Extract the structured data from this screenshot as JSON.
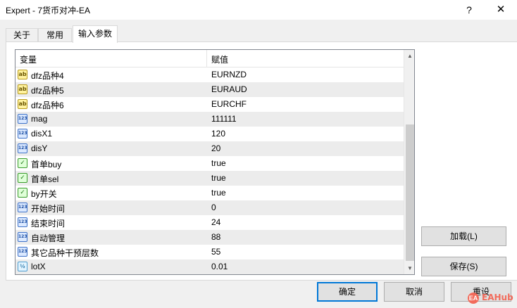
{
  "window": {
    "title": "Expert - 7货币对冲-EA",
    "help_label": "?",
    "close_label": "✕"
  },
  "tabs": [
    {
      "label": "关于"
    },
    {
      "label": "常用"
    },
    {
      "label": "输入参数"
    }
  ],
  "grid": {
    "col_variable": "变量",
    "col_value": "赋值",
    "rows": [
      {
        "icon": "string-type-icon",
        "icon_text": "ab",
        "type": "str",
        "variable": "dfz品种4",
        "value": "EURNZD"
      },
      {
        "icon": "string-type-icon",
        "icon_text": "ab",
        "type": "str",
        "variable": "dfz品种5",
        "value": "EURAUD"
      },
      {
        "icon": "string-type-icon",
        "icon_text": "ab",
        "type": "str",
        "variable": "dfz品种6",
        "value": "EURCHF"
      },
      {
        "icon": "integer-type-icon",
        "icon_text": "123",
        "type": "int",
        "variable": "mag",
        "value": "111111"
      },
      {
        "icon": "integer-type-icon",
        "icon_text": "123",
        "type": "int",
        "variable": "disX1",
        "value": "120"
      },
      {
        "icon": "integer-type-icon",
        "icon_text": "123",
        "type": "int",
        "variable": "disY",
        "value": "20"
      },
      {
        "icon": "boolean-type-icon",
        "icon_text": "✓",
        "type": "bool",
        "variable": "首单buy",
        "value": "true"
      },
      {
        "icon": "boolean-type-icon",
        "icon_text": "✓",
        "type": "bool",
        "variable": "首单sel",
        "value": "true"
      },
      {
        "icon": "boolean-type-icon",
        "icon_text": "✓",
        "type": "bool",
        "variable": "by开关",
        "value": "true"
      },
      {
        "icon": "integer-type-icon",
        "icon_text": "123",
        "type": "int",
        "variable": "开始时间",
        "value": "0"
      },
      {
        "icon": "integer-type-icon",
        "icon_text": "123",
        "type": "int",
        "variable": "结束时间",
        "value": "24"
      },
      {
        "icon": "integer-type-icon",
        "icon_text": "123",
        "type": "int",
        "variable": "自动管理",
        "value": "88"
      },
      {
        "icon": "integer-type-icon",
        "icon_text": "123",
        "type": "int",
        "variable": "其它品种干预层数",
        "value": "55"
      },
      {
        "icon": "double-type-icon",
        "icon_text": "½",
        "type": "dbl",
        "variable": "lotX",
        "value": "0.01"
      }
    ]
  },
  "side_buttons": {
    "load_label": "加载(L)",
    "save_label": "保存(S)"
  },
  "footer_buttons": {
    "ok_label": "确定",
    "cancel_label": "取消",
    "reset_label": "重设"
  },
  "watermark": {
    "logo_text": "EA",
    "text": "EAHub"
  },
  "scroll": {
    "up_icon": "▲",
    "down_icon": "▼"
  },
  "colors": {
    "accent": "#0078d7",
    "alt_row": "#ececec",
    "watermark": "#f26b5b"
  }
}
